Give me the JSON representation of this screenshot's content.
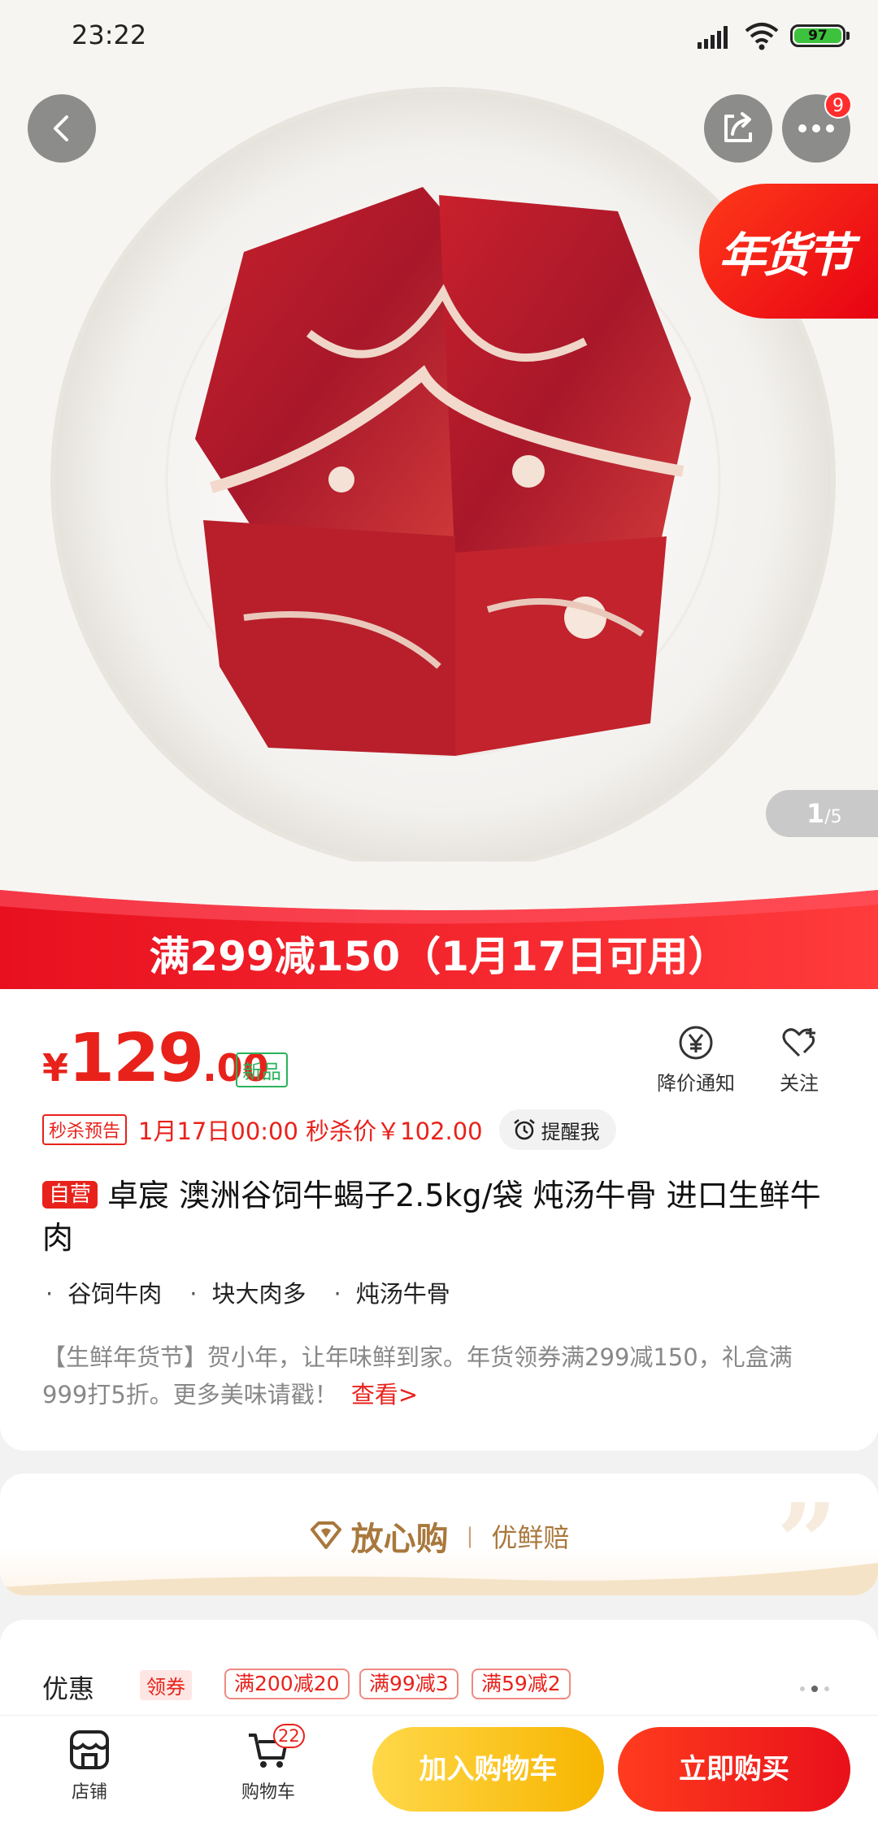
{
  "status_bar": {
    "time": "23:22",
    "battery": "97",
    "icons": [
      "signal-icon",
      "wifi-icon",
      "battery-icon"
    ]
  },
  "hero": {
    "icons": [
      "back-arrow-icon",
      "share-icon",
      "more-dots-icon"
    ],
    "more_badge": "9",
    "festival_badge": "年货节",
    "counter_current": "1",
    "counter_total": "/5"
  },
  "promo_banner": {
    "text": "满299减150（1月17日可用）",
    "colors": {
      "start": "#e8101f",
      "end": "#ff3b3b"
    }
  },
  "product": {
    "price_currency": "¥",
    "price_int": "129",
    "price_dec": ".00",
    "new_tag": "新品",
    "actions": [
      {
        "label": "降价通知",
        "icon": "yen-bell-icon"
      },
      {
        "label": "关注",
        "icon": "heart-plus-icon"
      }
    ],
    "flash_tag": "秒杀预告",
    "flash_text": "1月17日00:00 秒杀价￥102.00",
    "remind_label": "提醒我",
    "self_op_tag": "自营",
    "title": "卓宸 澳洲谷饲牛蝎子2.5kg/袋 炖汤牛骨 进口生鲜牛肉",
    "features": [
      "谷饲牛肉",
      "块大肉多",
      "炖汤牛骨"
    ],
    "description": "【生鲜年货节】贺小年，让年味鲜到家。年货领券满299减150，礼盒满999打5折。更多美味请戳！",
    "view_more": "查看>",
    "accent_color": "#e8221b"
  },
  "assurance": {
    "title": "放心购",
    "separator": "|",
    "subtitle": "优鲜赔"
  },
  "coupons": {
    "label": "优惠",
    "claim": "领券",
    "items": [
      "满200减20",
      "满99减3",
      "满59减2"
    ]
  },
  "bottom_bar": {
    "store_label": "店铺",
    "cart_label": "购物车",
    "cart_badge": "22",
    "add_to_cart": "加入购物车",
    "buy_now": "立即购买"
  }
}
